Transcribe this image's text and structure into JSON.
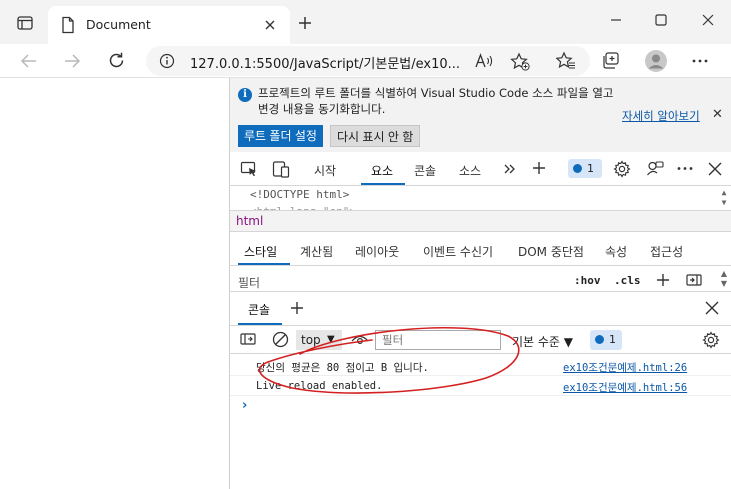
{
  "browser": {
    "tab_title": "Document",
    "url": "127.0.0.1:5500/JavaScript/기본문법/ex10..."
  },
  "infobar": {
    "message": "프로젝트의 루트 폴더를 식별하여 Visual Studio Code 소스 파일을 열고 변경 내용을 동기화합니다.",
    "learn_more": "자세히 알아보기",
    "primary_button": "루트 폴더 설정",
    "secondary_button": "다시 표시 안 함"
  },
  "devtools": {
    "tabs": [
      "시작",
      "요소",
      "콘솔",
      "소스"
    ],
    "active_tab": "요소",
    "issues_count": "1",
    "dom_line": "<!DOCTYPE html>",
    "dom_line2": "<html lang=\"en\">",
    "breadcrumb": "html",
    "style_tabs": [
      "스타일",
      "계산됨",
      "레이아웃",
      "이벤트 수신기",
      "DOM 중단점",
      "속성",
      "접근성"
    ],
    "filter_placeholder": "필터",
    "hov": ":hov",
    "cls": ".cls"
  },
  "console": {
    "drawer_tab": "콘솔",
    "context": "top",
    "filter_placeholder": "필터",
    "level": "기본 수준 ▼",
    "issues_count": "1",
    "messages": [
      {
        "text": "당신의 평균은 80 점이고 B 입니다.",
        "source": "ex10조건문예제.html:26"
      },
      {
        "text": "Live reload enabled.",
        "source": "ex10조건문예제.html:56"
      }
    ],
    "prompt": "›"
  },
  "colors": {
    "accent": "#0f6cbd",
    "annotation": "#d42020",
    "link": "#0b57a8"
  }
}
